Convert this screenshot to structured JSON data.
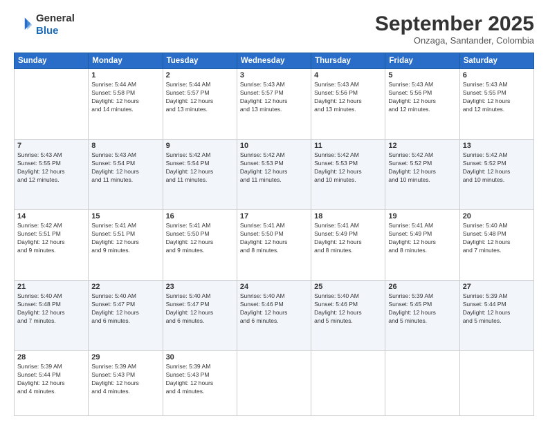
{
  "header": {
    "logo_line1": "General",
    "logo_line2": "Blue",
    "month": "September 2025",
    "location": "Onzaga, Santander, Colombia"
  },
  "days_of_week": [
    "Sunday",
    "Monday",
    "Tuesday",
    "Wednesday",
    "Thursday",
    "Friday",
    "Saturday"
  ],
  "weeks": [
    [
      {
        "day": "",
        "info": ""
      },
      {
        "day": "1",
        "info": "Sunrise: 5:44 AM\nSunset: 5:58 PM\nDaylight: 12 hours\nand 14 minutes."
      },
      {
        "day": "2",
        "info": "Sunrise: 5:44 AM\nSunset: 5:57 PM\nDaylight: 12 hours\nand 13 minutes."
      },
      {
        "day": "3",
        "info": "Sunrise: 5:43 AM\nSunset: 5:57 PM\nDaylight: 12 hours\nand 13 minutes."
      },
      {
        "day": "4",
        "info": "Sunrise: 5:43 AM\nSunset: 5:56 PM\nDaylight: 12 hours\nand 13 minutes."
      },
      {
        "day": "5",
        "info": "Sunrise: 5:43 AM\nSunset: 5:56 PM\nDaylight: 12 hours\nand 12 minutes."
      },
      {
        "day": "6",
        "info": "Sunrise: 5:43 AM\nSunset: 5:55 PM\nDaylight: 12 hours\nand 12 minutes."
      }
    ],
    [
      {
        "day": "7",
        "info": "Sunrise: 5:43 AM\nSunset: 5:55 PM\nDaylight: 12 hours\nand 12 minutes."
      },
      {
        "day": "8",
        "info": "Sunrise: 5:43 AM\nSunset: 5:54 PM\nDaylight: 12 hours\nand 11 minutes."
      },
      {
        "day": "9",
        "info": "Sunrise: 5:42 AM\nSunset: 5:54 PM\nDaylight: 12 hours\nand 11 minutes."
      },
      {
        "day": "10",
        "info": "Sunrise: 5:42 AM\nSunset: 5:53 PM\nDaylight: 12 hours\nand 11 minutes."
      },
      {
        "day": "11",
        "info": "Sunrise: 5:42 AM\nSunset: 5:53 PM\nDaylight: 12 hours\nand 10 minutes."
      },
      {
        "day": "12",
        "info": "Sunrise: 5:42 AM\nSunset: 5:52 PM\nDaylight: 12 hours\nand 10 minutes."
      },
      {
        "day": "13",
        "info": "Sunrise: 5:42 AM\nSunset: 5:52 PM\nDaylight: 12 hours\nand 10 minutes."
      }
    ],
    [
      {
        "day": "14",
        "info": "Sunrise: 5:42 AM\nSunset: 5:51 PM\nDaylight: 12 hours\nand 9 minutes."
      },
      {
        "day": "15",
        "info": "Sunrise: 5:41 AM\nSunset: 5:51 PM\nDaylight: 12 hours\nand 9 minutes."
      },
      {
        "day": "16",
        "info": "Sunrise: 5:41 AM\nSunset: 5:50 PM\nDaylight: 12 hours\nand 9 minutes."
      },
      {
        "day": "17",
        "info": "Sunrise: 5:41 AM\nSunset: 5:50 PM\nDaylight: 12 hours\nand 8 minutes."
      },
      {
        "day": "18",
        "info": "Sunrise: 5:41 AM\nSunset: 5:49 PM\nDaylight: 12 hours\nand 8 minutes."
      },
      {
        "day": "19",
        "info": "Sunrise: 5:41 AM\nSunset: 5:49 PM\nDaylight: 12 hours\nand 8 minutes."
      },
      {
        "day": "20",
        "info": "Sunrise: 5:40 AM\nSunset: 5:48 PM\nDaylight: 12 hours\nand 7 minutes."
      }
    ],
    [
      {
        "day": "21",
        "info": "Sunrise: 5:40 AM\nSunset: 5:48 PM\nDaylight: 12 hours\nand 7 minutes."
      },
      {
        "day": "22",
        "info": "Sunrise: 5:40 AM\nSunset: 5:47 PM\nDaylight: 12 hours\nand 6 minutes."
      },
      {
        "day": "23",
        "info": "Sunrise: 5:40 AM\nSunset: 5:47 PM\nDaylight: 12 hours\nand 6 minutes."
      },
      {
        "day": "24",
        "info": "Sunrise: 5:40 AM\nSunset: 5:46 PM\nDaylight: 12 hours\nand 6 minutes."
      },
      {
        "day": "25",
        "info": "Sunrise: 5:40 AM\nSunset: 5:46 PM\nDaylight: 12 hours\nand 5 minutes."
      },
      {
        "day": "26",
        "info": "Sunrise: 5:39 AM\nSunset: 5:45 PM\nDaylight: 12 hours\nand 5 minutes."
      },
      {
        "day": "27",
        "info": "Sunrise: 5:39 AM\nSunset: 5:44 PM\nDaylight: 12 hours\nand 5 minutes."
      }
    ],
    [
      {
        "day": "28",
        "info": "Sunrise: 5:39 AM\nSunset: 5:44 PM\nDaylight: 12 hours\nand 4 minutes."
      },
      {
        "day": "29",
        "info": "Sunrise: 5:39 AM\nSunset: 5:43 PM\nDaylight: 12 hours\nand 4 minutes."
      },
      {
        "day": "30",
        "info": "Sunrise: 5:39 AM\nSunset: 5:43 PM\nDaylight: 12 hours\nand 4 minutes."
      },
      {
        "day": "",
        "info": ""
      },
      {
        "day": "",
        "info": ""
      },
      {
        "day": "",
        "info": ""
      },
      {
        "day": "",
        "info": ""
      }
    ]
  ]
}
